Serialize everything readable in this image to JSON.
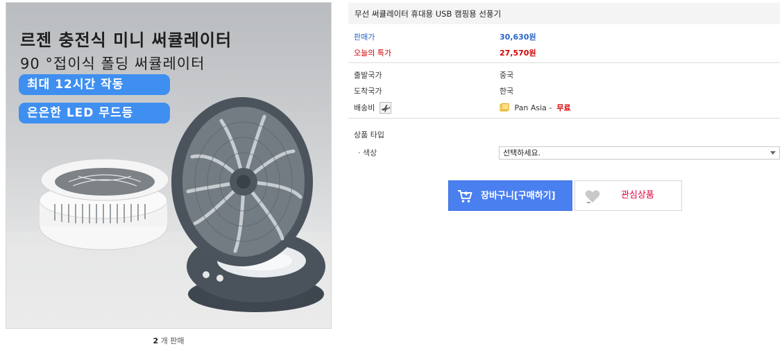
{
  "product_image": {
    "headline": "르젠 충전식 미니 써큘레이터",
    "subhead": "90 °접이식 폴딩 써큘레이터",
    "badges": [
      "최대 12시간 작동",
      "은은한 LED 무드등"
    ]
  },
  "sales": {
    "count": "2",
    "suffix": "개 판매"
  },
  "product": {
    "title": "무선 써큘레이터 휴대용 USB 캠핑용 선풍기"
  },
  "price": {
    "label": "판매가",
    "value": "30,630원",
    "special_label": "오늘의 특가",
    "special_value": "27,570원"
  },
  "shipping": {
    "origin_label": "출발국가",
    "origin_value": "중국",
    "dest_label": "도착국가",
    "dest_value": "한국",
    "fee_label": "배송비",
    "carrier": "Pan Asia -",
    "fee_value": "무료"
  },
  "options": {
    "section_label": "상품 타입",
    "color_label": "· 색상",
    "color_select": "선택하세요."
  },
  "buttons": {
    "cart": "장바구니[구매하기]",
    "wish": "관심상품"
  },
  "colors": {
    "accent_blue": "#4a7ff0",
    "price_red": "#d20000",
    "price_blue": "#2a63c7",
    "wish_red": "#e0003a"
  },
  "icons": [
    "cart-icon",
    "heart-icon",
    "airplane-icon",
    "shipping-box-icon",
    "chevron-down-icon"
  ]
}
